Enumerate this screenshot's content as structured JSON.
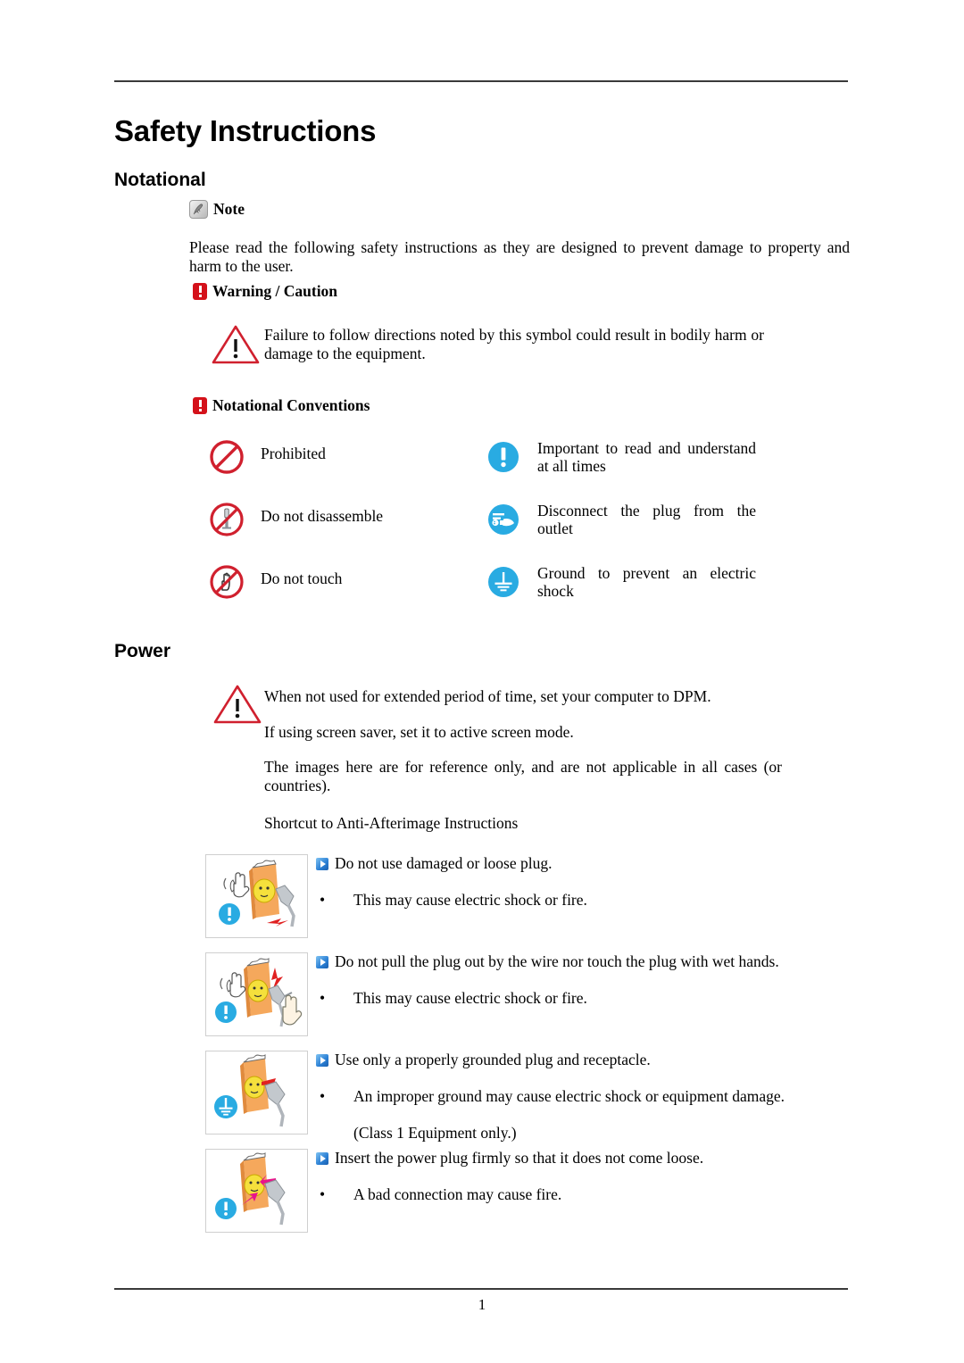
{
  "document": {
    "title": "Safety Instructions",
    "page_number": "1"
  },
  "notational": {
    "heading": "Notational",
    "note_label": "Note",
    "note_paragraph": "Please read the following safety instructions as they are designed to prevent damage to property and harm to the user.",
    "warning_label": "Warning / Caution",
    "warning_paragraph": "Failure to follow directions noted by this symbol could result in bodily harm or damage to the equipment.",
    "conventions_label": "Notational Conventions",
    "conventions": [
      {
        "icon": "prohibited-icon",
        "label": "Prohibited"
      },
      {
        "icon": "important-read-icon",
        "label": "Important to read and understand at all times"
      },
      {
        "icon": "do-not-disassemble-icon",
        "label": "Do not disassemble"
      },
      {
        "icon": "disconnect-plug-icon",
        "label": "Disconnect the plug from the outlet"
      },
      {
        "icon": "do-not-touch-icon",
        "label": "Do not touch"
      },
      {
        "icon": "ground-icon",
        "label": "Ground to prevent an electric shock"
      }
    ]
  },
  "power": {
    "heading": "Power",
    "notes": [
      "When not used for extended period of time, set your computer to DPM.",
      "If using screen saver, set it to active screen mode.",
      "The images here are for reference only, and are not applicable in all cases (or countries).",
      "Shortcut to Anti-Afterimage Instructions"
    ],
    "items": [
      {
        "illustration": "damaged-loose-plug-illustration",
        "badge": "important-badge",
        "headline": "Do not use damaged or loose plug.",
        "bullets": [
          "This may cause electric shock or fire."
        ],
        "extra": ""
      },
      {
        "illustration": "pull-plug-wet-hands-illustration",
        "badge": "important-badge",
        "headline": "Do not pull the plug out by the wire nor touch the plug with wet hands.",
        "bullets": [
          "This may cause electric shock or fire."
        ],
        "extra": ""
      },
      {
        "illustration": "grounded-plug-illustration",
        "badge": "ground-badge",
        "headline": "Use only a properly grounded plug and receptacle.",
        "bullets": [
          "An improper ground may cause electric shock or equipment damage."
        ],
        "extra": "(Class 1 Equipment only.)"
      },
      {
        "illustration": "insert-plug-firmly-illustration",
        "badge": "important-badge",
        "headline": "Insert the power plug firmly so that it does not come loose.",
        "bullets": [
          "A bad connection may cause fire."
        ],
        "extra": ""
      }
    ],
    "bullet_glyph": "•"
  },
  "colors": {
    "warning_red": "#d4111a",
    "prohibit_red": "#d0202e",
    "info_blue": "#29abe2",
    "arrow_blue": "#2a7fd4",
    "rule_gray": "#3a3a3a",
    "box_border": "#cfcfcf",
    "illustration_orange": "#f5a85c",
    "illustration_yellow": "#f5e03c",
    "illustration_gray": "#b9bec4"
  }
}
